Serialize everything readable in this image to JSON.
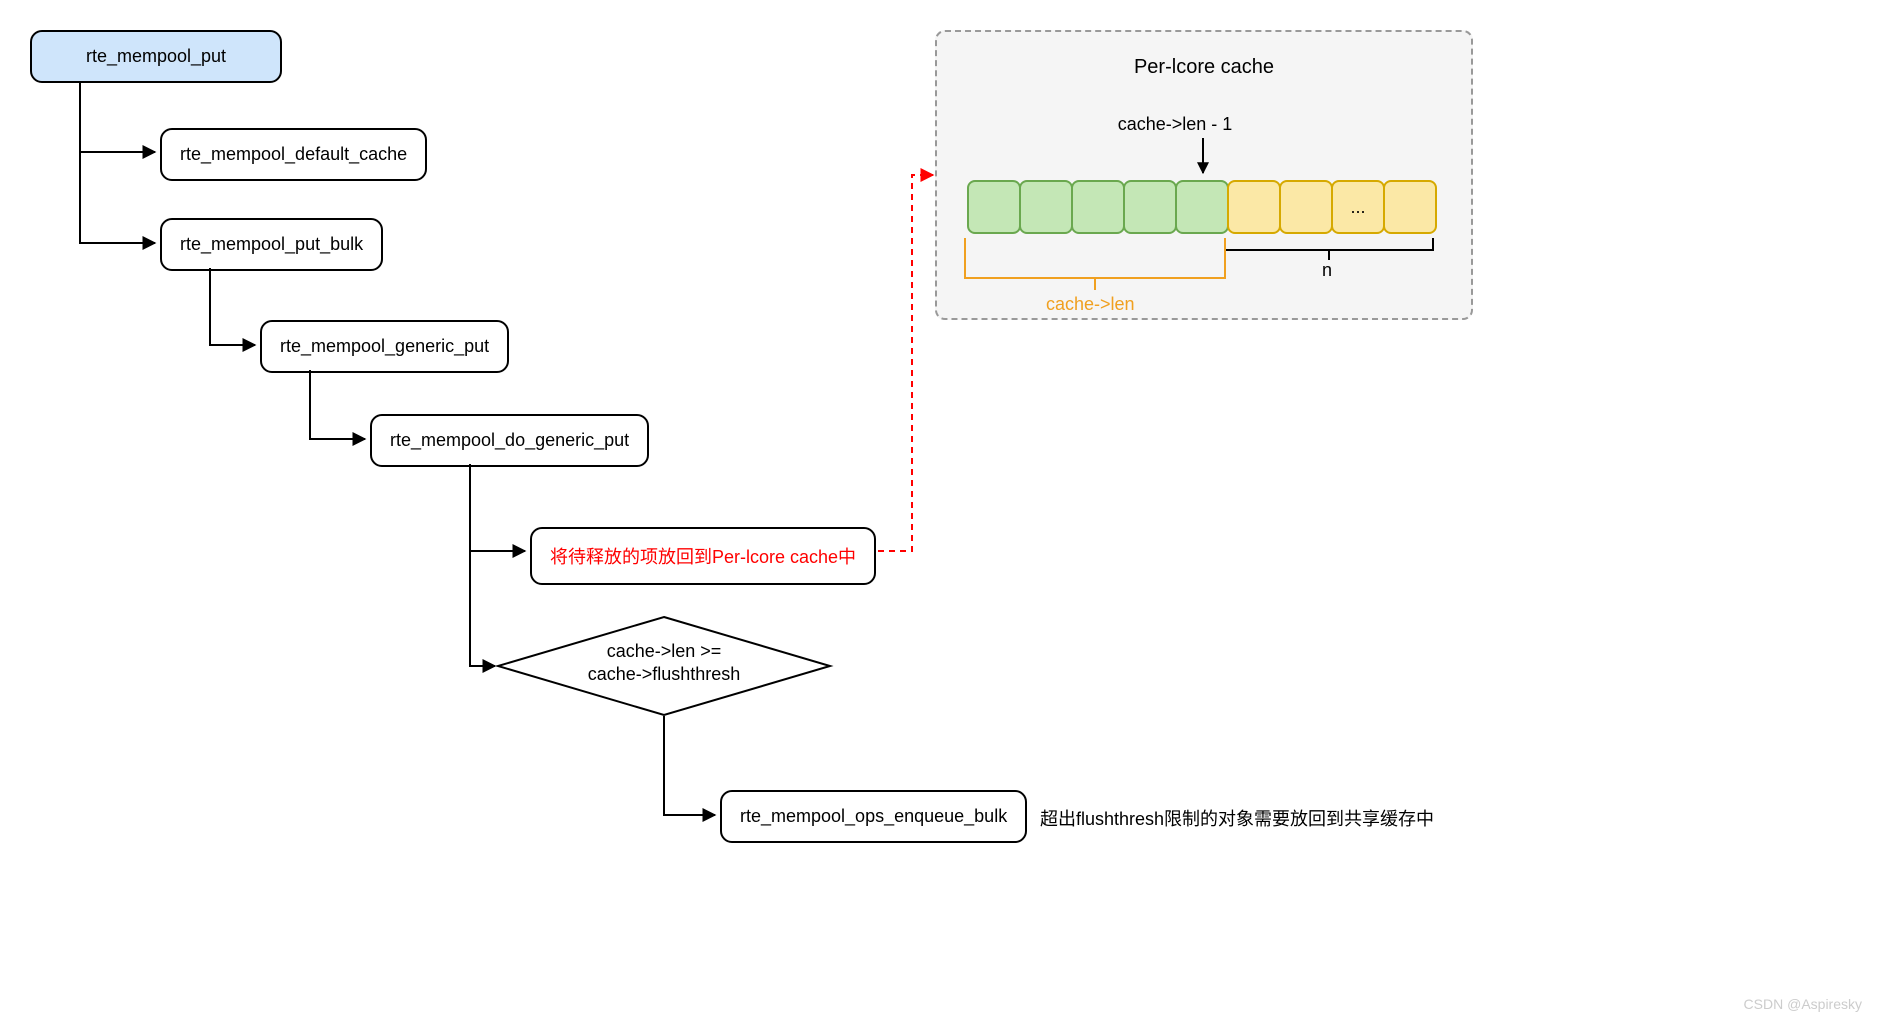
{
  "flow": {
    "root": "rte_mempool_put",
    "n1": "rte_mempool_default_cache",
    "n2": "rte_mempool_put_bulk",
    "n3": "rte_mempool_generic_put",
    "n4": "rte_mempool_do_generic_put",
    "n5": "将待释放的项放回到Per-lcore cache中",
    "diamond_line1": "cache->len >=",
    "diamond_line2": "cache->flushthresh",
    "n6": "rte_mempool_ops_enqueue_bulk",
    "n6_note": "超出flushthresh限制的对象需要放回到共享缓存中"
  },
  "cache": {
    "title": "Per-lcore cache",
    "pointer_label": "cache->len - 1",
    "ellipsis": "...",
    "bracket_n": "n",
    "bracket_len": "cache->len"
  },
  "watermark": "CSDN @Aspiresky"
}
